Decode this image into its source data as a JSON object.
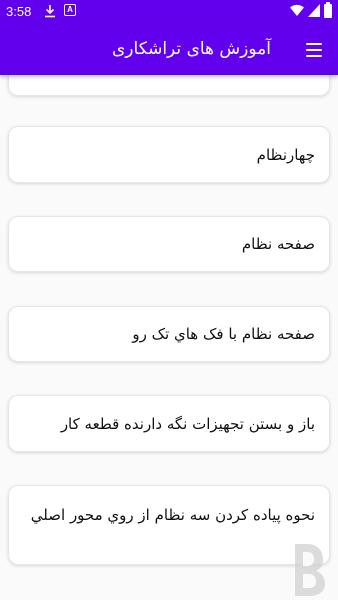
{
  "status": {
    "time": "3:58",
    "a_badge": "A"
  },
  "app_bar": {
    "title": "آموزش های تراشکاری",
    "menu_icon": "hamburger-menu-icon"
  },
  "items": [
    {
      "label": ""
    },
    {
      "label": "چهارنظام"
    },
    {
      "label": "صفحه نظام"
    },
    {
      "label": "صفحه نظام با فک هاي تک رو"
    },
    {
      "label": "باز و بستن تجهيزات نگه دارنده قطعه کار"
    },
    {
      "label": "نحوه پياده کردن سه نظام از روي محور اصلي"
    }
  ],
  "colors": {
    "primary": "#6200ee",
    "background": "#fafafa",
    "card": "#ffffff"
  },
  "watermark_icon": "bazaar-logo-icon"
}
